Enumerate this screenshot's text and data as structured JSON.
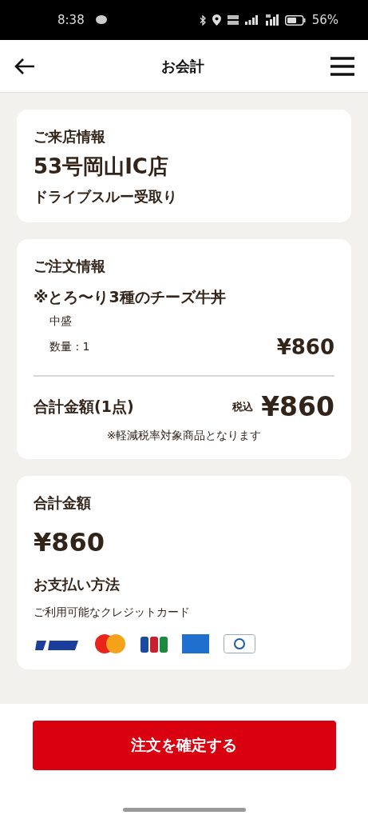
{
  "status_bar": {
    "time": "8:38",
    "battery": "56%"
  },
  "header": {
    "title": "お会計"
  },
  "store_info": {
    "heading": "ご来店情報",
    "store_name": "53号岡山IC店",
    "pickup": "ドライブスルー受取り"
  },
  "order_info": {
    "heading": "ご注文情報",
    "items": [
      {
        "name": "※とろ〜り3種のチーズ牛丼",
        "option": "中盛",
        "quantity": "数量 : 1",
        "price": "¥860"
      }
    ],
    "total_label": "合計金額(1点)",
    "tax_label": "税込",
    "total_price": "¥860",
    "note": "※軽減税率対象商品となります"
  },
  "payment": {
    "total_heading": "合計金額",
    "total": "¥860",
    "method_heading": "お支払い方法",
    "cards_label": "ご利用可能なクレジットカード"
  },
  "confirm_button": "注文を確定する"
}
